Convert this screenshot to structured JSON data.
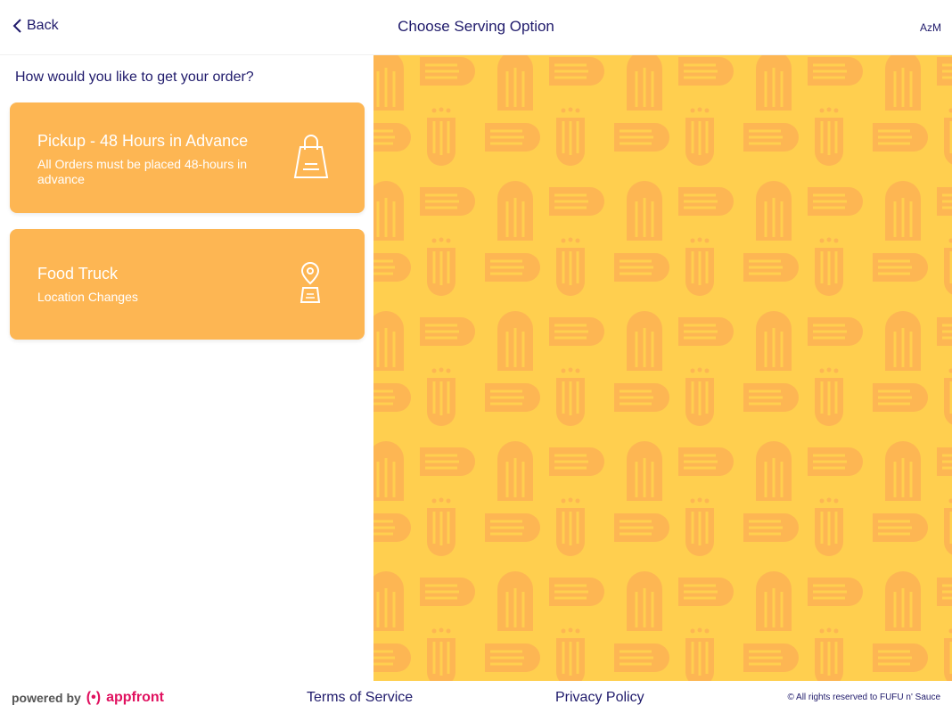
{
  "header": {
    "back_label": "Back",
    "title": "Choose Serving Option",
    "user_label": "AzM"
  },
  "main": {
    "question": "How would you like to get your order?",
    "options": [
      {
        "title": "Pickup - 48 Hours in Advance",
        "subtitle": "All Orders must be placed 48-hours in advance",
        "icon": "shopping-bag-icon"
      },
      {
        "title": "Food Truck",
        "subtitle": "Location Changes",
        "icon": "location-pin-icon"
      }
    ]
  },
  "footer": {
    "powered_by": "powered by",
    "brand_mark": "(•)",
    "brand": "appfront",
    "terms": "Terms of Service",
    "privacy": "Privacy Policy",
    "copyright": "© All rights reserved to FUFU n' Sauce"
  },
  "colors": {
    "accent": "#fdb653",
    "text": "#1f1a6b",
    "pattern_bg": "#ffcf4f",
    "pattern_fg": "#fdb653",
    "brand": "#e0115f"
  }
}
